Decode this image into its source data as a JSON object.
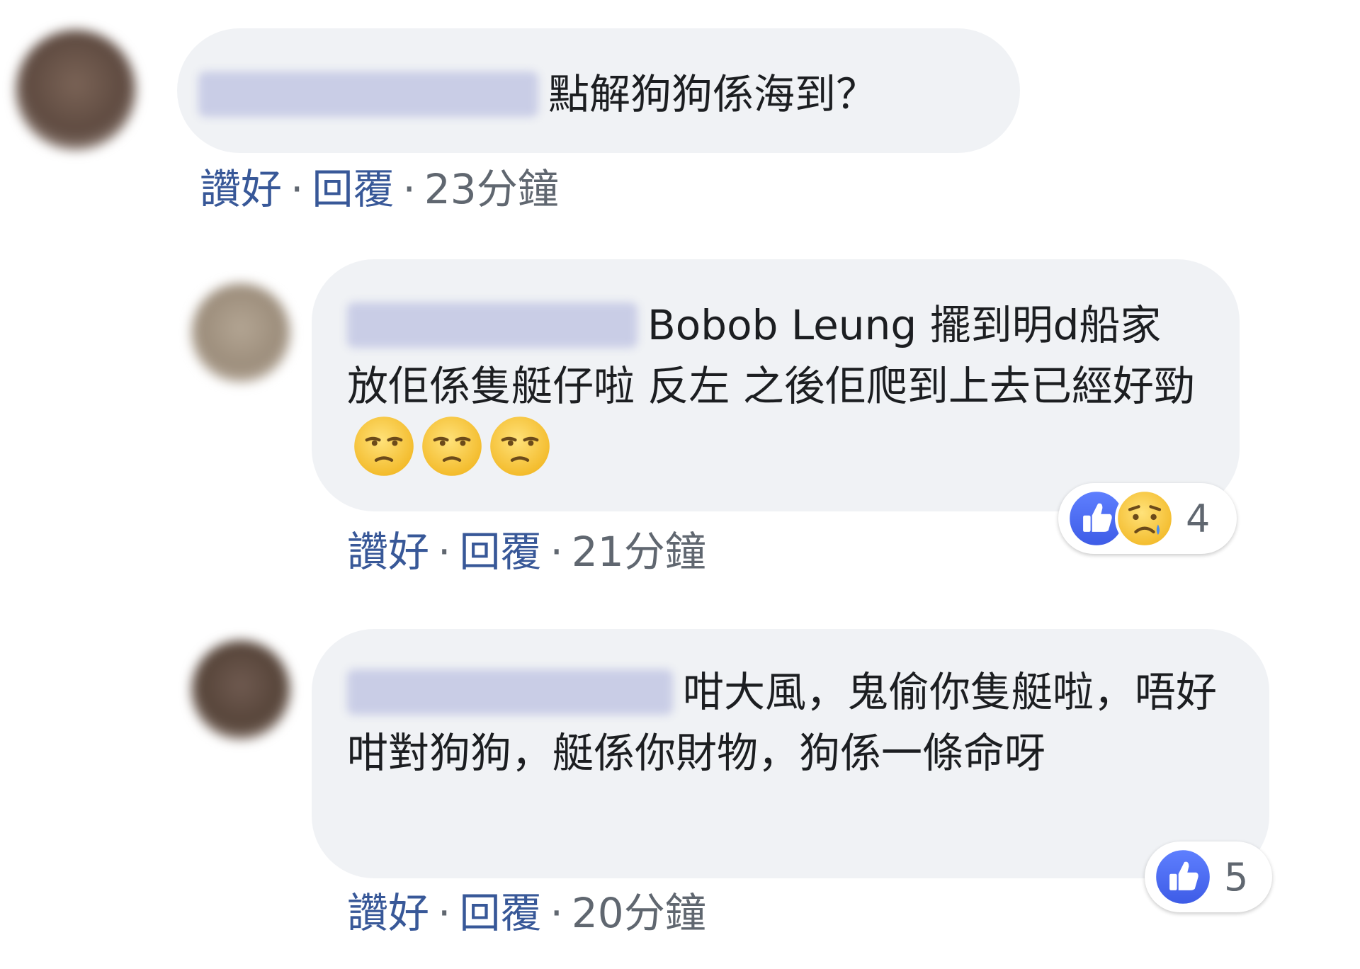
{
  "comments": [
    {
      "text": "點解狗狗係海到？",
      "actions": {
        "like": "讚好",
        "reply": "回覆",
        "time": "23分鐘"
      }
    },
    {
      "text": "Bobob Leung 擺到明d船家放佢係隻艇仔啦 反左 之後佢爬到上去已經好勁",
      "emoji_icons": [
        "unamused-emoji-icon",
        "unamused-emoji-icon",
        "unamused-emoji-icon"
      ],
      "actions": {
        "like": "讚好",
        "reply": "回覆",
        "time": "21分鐘"
      },
      "reactions": {
        "icons": [
          "like-reaction-icon",
          "sad-reaction-icon"
        ],
        "count": "4"
      }
    },
    {
      "text": "咁大風，鬼偷你隻艇啦，唔好咁對狗狗，艇係你財物，狗係一條命呀",
      "actions": {
        "like": "讚好",
        "reply": "回覆",
        "time": "20分鐘"
      },
      "reactions": {
        "icons": [
          "like-reaction-icon"
        ],
        "count": "5"
      }
    }
  ],
  "colors": {
    "bubble": "#f0f2f5",
    "link": "#385898",
    "meta": "#606770",
    "like_blue": "#4f6ef2",
    "emoji_yellow": "#f7c843"
  }
}
